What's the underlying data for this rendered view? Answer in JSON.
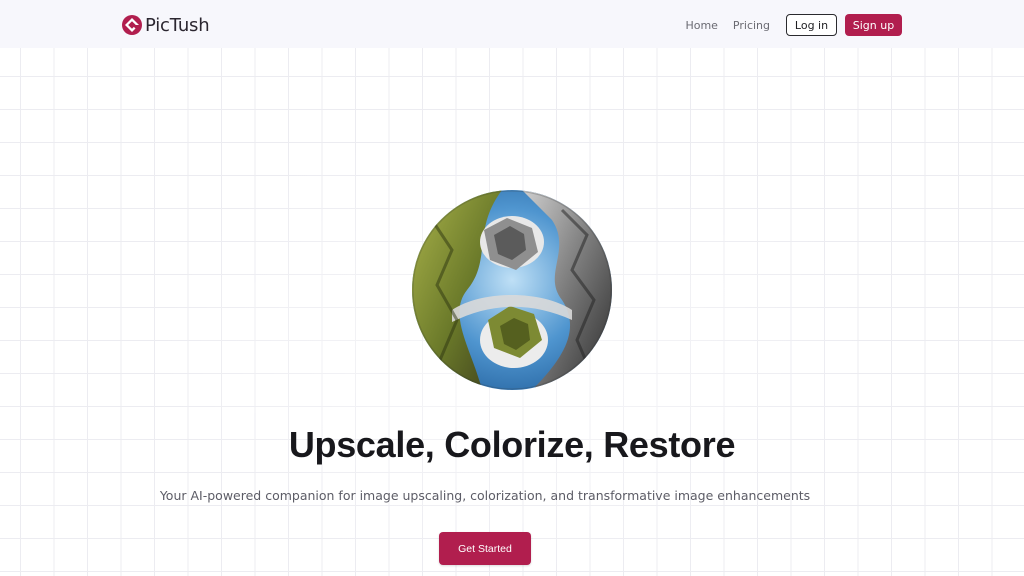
{
  "header": {
    "brand": "PicTush",
    "nav": {
      "home": "Home",
      "pricing": "Pricing",
      "login": "Log in",
      "signup": "Sign up"
    }
  },
  "hero": {
    "title": "Upscale, Colorize, Restore",
    "subtitle": "Your AI-powered companion for image upscaling, colorization, and transformative image enhancements",
    "cta": "Get Started",
    "image_icon": "circular-collage-mountain-sky-image"
  },
  "colors": {
    "brand": "#b11e4e",
    "text_dark": "#18181c",
    "text_muted": "#5c5c66",
    "header_bg": "#f7f7fc",
    "grid": "#ececf1"
  }
}
